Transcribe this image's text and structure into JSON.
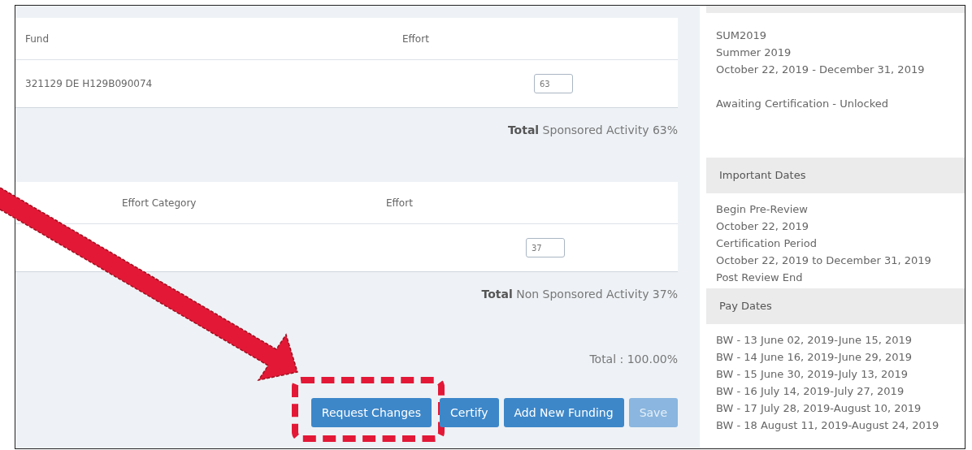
{
  "sponsored": {
    "columns": [
      "Fund",
      "Effort"
    ],
    "rows": [
      {
        "fund": "321129 DE H129B090074",
        "effort": "63"
      }
    ],
    "total": "**Total** Sponsored Activity 63%"
  },
  "non_sponsored": {
    "columns": [
      "Effort Category",
      "Effort"
    ],
    "rows": [
      {
        "category": "",
        "effort": "37"
      }
    ],
    "total": "**Total** Non Sponsored Activity 37%"
  },
  "grand_total": "Total : 100.00%",
  "buttons": [
    {
      "label": "Request Changes",
      "disabled": false,
      "highlighted": true
    },
    {
      "label": "Certify",
      "disabled": false,
      "highlighted": false
    },
    {
      "label": "Add New Funding",
      "disabled": false,
      "highlighted": false
    },
    {
      "label": "Save",
      "disabled": true,
      "highlighted": false
    }
  ],
  "sidebar": {
    "period_lines": [
      "SUM2019",
      "Summer 2019",
      "October 22, 2019 - December 31, 2019"
    ],
    "status": "Awaiting Certification - Unlocked",
    "sections": [
      {
        "title": "Important Dates",
        "lines": [
          "Begin Pre-Review",
          "October 22, 2019",
          "Certification Period",
          "October 22, 2019 to December 31, 2019",
          "Post Review End"
        ]
      },
      {
        "title": "Pay Dates",
        "lines": [
          "BW - 13 June 02, 2019-June 15, 2019",
          "BW - 14 June 16, 2019-June 29, 2019",
          "BW - 15 June 30, 2019-July 13, 2019",
          "BW - 16 July 14, 2019-July 27, 2019",
          "BW - 17 July 28, 2019-August 10, 2019",
          "BW - 18 August 11, 2019-August 24, 2019"
        ]
      }
    ]
  }
}
